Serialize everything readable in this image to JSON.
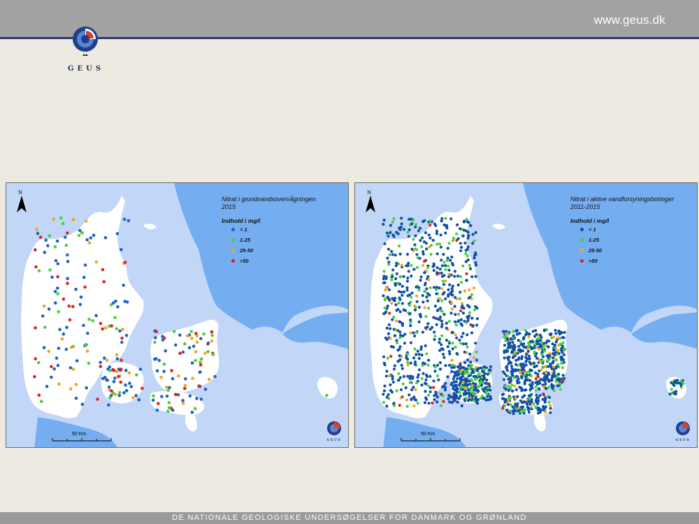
{
  "header": {
    "url": "www.geus.dk",
    "logo_text": "GEUS"
  },
  "footer": {
    "text": "DE NATIONALE GEOLOGISKE UNDERSØGELSER FOR DANMARK OG GRØNLAND"
  },
  "maps": [
    {
      "title_line1": "Nitrat i grundvandsovervågningen",
      "title_line2": "2015",
      "unit_label": "Indhold i mg/l",
      "north_label": "N",
      "scale_label": "50 Km",
      "legend": [
        {
          "label": "< 1",
          "color": "#1e62c9"
        },
        {
          "label": "1-25",
          "color": "#46d23a"
        },
        {
          "label": "25-50",
          "color": "#f5a418"
        },
        {
          "label": ">50",
          "color": "#e41f1f"
        }
      ],
      "logo_text": "GEUS"
    },
    {
      "title_line1": "Nitrat i aktive vandforsyningsboringer",
      "title_line2": "2011-2015",
      "unit_label": "Indhold i mg/l",
      "north_label": "N",
      "scale_label": "50 Km",
      "legend": [
        {
          "label": "< 1",
          "color": "#0f4fa8"
        },
        {
          "label": "1-25",
          "color": "#46d23a"
        },
        {
          "label": "25-50",
          "color": "#f5a418"
        },
        {
          "label": ">50",
          "color": "#e41f1f"
        }
      ],
      "logo_text": "GEUS"
    }
  ],
  "colors": {
    "sea_light": "#c2d6f7",
    "sea_dark": "#74aef0",
    "land": "#ffffff",
    "topbar": "#a2a2a2",
    "rule": "#2f3a6e",
    "page_bg": "#edeae1"
  }
}
